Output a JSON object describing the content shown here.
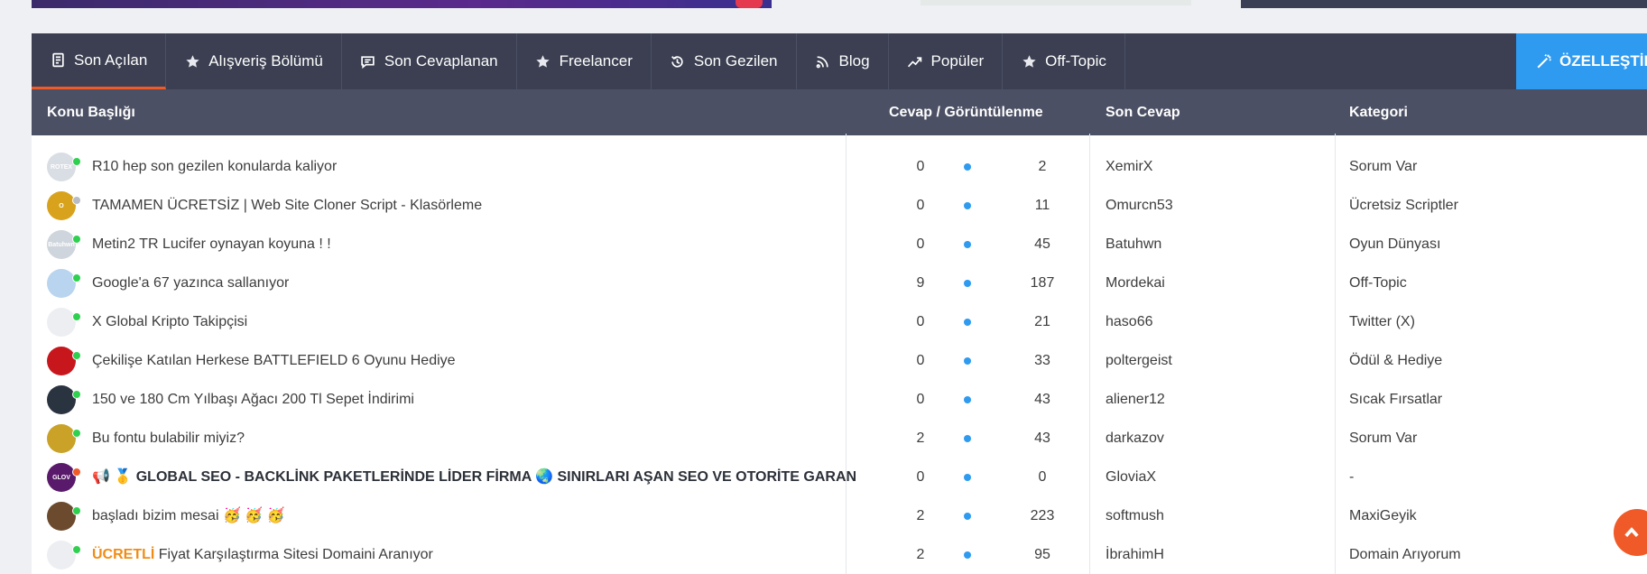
{
  "colors": {
    "tab_bar": "#3b3f51",
    "header": "#4c5064",
    "accent_orange": "#f05a28",
    "accent_blue": "#2e9bf0",
    "online": "#2fd04f"
  },
  "tabs": [
    {
      "label": "Son Açılan",
      "icon": "document-icon"
    },
    {
      "label": "Alışveriş Bölümü",
      "icon": "star-icon"
    },
    {
      "label": "Son Cevaplanan",
      "icon": "chat-icon"
    },
    {
      "label": "Freelancer",
      "icon": "star-icon"
    },
    {
      "label": "Son Gezilen",
      "icon": "history-icon"
    },
    {
      "label": "Blog",
      "icon": "rss-icon"
    },
    {
      "label": "Popüler",
      "icon": "trend-icon"
    },
    {
      "label": "Off-Topic",
      "icon": "star-icon"
    }
  ],
  "customize_label": "ÖZELLEŞTİR",
  "columns": {
    "topic": "Konu Başlığı",
    "replies_views": "Cevap / Görüntülenme",
    "last_reply": "Son Cevap",
    "category": "Kategori"
  },
  "topics": [
    {
      "title": "R10 hep son gezilen konularda kaliyor",
      "replies": "0",
      "views": "2",
      "last": "XemirX",
      "category": "Sorum Var",
      "avatar_text": "ROTEX",
      "avatar_color": "#d9dde4",
      "status": "#2fd04f"
    },
    {
      "title": "TAMAMEN ÜCRETSİZ | Web Site Cloner Script - Klasörleme",
      "replies": "0",
      "views": "11",
      "last": "Omurcn53",
      "category": "Ücretsiz Scriptler",
      "avatar_text": "O",
      "avatar_color": "#d8a21c",
      "status": "#b8bcc4"
    },
    {
      "title": "Metin2 TR Lucifer oynayan koyuna ! !",
      "replies": "0",
      "views": "45",
      "last": "Batuhwn",
      "category": "Oyun Dünyası",
      "avatar_text": "Batuhwn",
      "avatar_color": "#cfd5dc",
      "status": "#2fd04f"
    },
    {
      "title": "Google'a 67 yazınca sallanıyor",
      "replies": "9",
      "views": "187",
      "last": "Mordekai",
      "category": "Off-Topic",
      "avatar_text": "",
      "avatar_color": "#b9d4ee",
      "status": "#2fd04f"
    },
    {
      "title": "X Global Kripto Takipçisi",
      "replies": "0",
      "views": "21",
      "last": "haso66",
      "category": "Twitter (X)",
      "avatar_text": "",
      "avatar_color": "#eceef2",
      "status": "#2fd04f"
    },
    {
      "title": "Çekilişe Katılan Herkese BATTLEFIELD 6 Oyunu Hediye",
      "replies": "0",
      "views": "33",
      "last": "poltergeist",
      "category": "Ödül & Hediye",
      "avatar_text": "",
      "avatar_color": "#c8161d",
      "status": "#2fd04f"
    },
    {
      "title": "150 ve 180 Cm Yılbaşı Ağacı 200 Tl Sepet İndirimi",
      "replies": "0",
      "views": "43",
      "last": "aliener12",
      "category": "Sıcak Fırsatlar",
      "avatar_text": "",
      "avatar_color": "#2a3340",
      "status": "#2fd04f"
    },
    {
      "title": "Bu fontu bulabilir miyiz?",
      "replies": "2",
      "views": "43",
      "last": "darkazov",
      "category": "Sorum Var",
      "avatar_text": "",
      "avatar_color": "#c9a227",
      "status": "#2fd04f"
    },
    {
      "title": "📢 🥇 GLOBAL SEO - BACKLİNK PAKETLERİNDE LİDER FİRMA 🌏 SINIRLARI AŞAN SEO VE OTORİTE GARAN",
      "replies": "0",
      "views": "0",
      "last": "GloviaX",
      "category": "-",
      "avatar_text": "GLOV",
      "avatar_color": "#5a1a6b",
      "status": "#f05a28",
      "bold": true
    },
    {
      "title": "başladı bizim mesai 🥳 🥳 🥳",
      "replies": "2",
      "views": "223",
      "last": "softmush",
      "category": "MaxiGeyik",
      "avatar_text": "",
      "avatar_color": "#6b4a2e",
      "status": "#2fd04f"
    },
    {
      "prefix": "ÜCRETLİ",
      "title": "Fiyat Karşılaştırma Sitesi Domaini Aranıyor",
      "replies": "2",
      "views": "95",
      "last": "İbrahimH",
      "category": "Domain Arıyorum",
      "avatar_text": "",
      "avatar_color": "#eceef2",
      "status": "#2fd04f"
    }
  ]
}
